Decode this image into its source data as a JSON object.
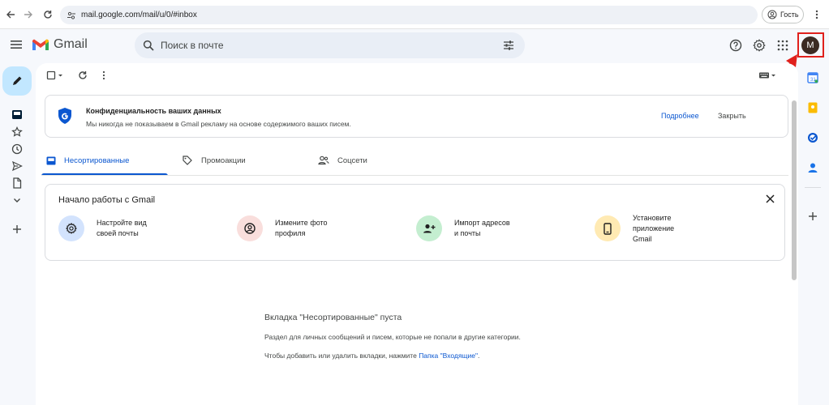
{
  "browser": {
    "url": "mail.google.com/mail/u/0/#inbox",
    "profile_label": "Гость"
  },
  "header": {
    "brand": "Gmail",
    "search_placeholder": "Поиск в почте",
    "avatar_letter": "M"
  },
  "privacy_banner": {
    "title": "Конфиденциальность ваших данных",
    "text": "Мы никогда не показываем в Gmail рекламу на основе содержимого ваших писем.",
    "more_label": "Подробнее",
    "close_label": "Закрыть"
  },
  "tabs": [
    {
      "label": "Несортированные",
      "active": true
    },
    {
      "label": "Промоакции",
      "active": false
    },
    {
      "label": "Соцсети",
      "active": false
    }
  ],
  "getting_started": {
    "title": "Начало работы с Gmail",
    "items": [
      {
        "label": "Настройте вид\nсвоей почты",
        "icon": "gear-icon",
        "color": "#d3e3fd"
      },
      {
        "label": "Измените фото\nпрофиля",
        "icon": "account-circle-icon",
        "color": "#f9dedc"
      },
      {
        "label": "Импорт адресов\nи почты",
        "icon": "person-add-icon",
        "color": "#c4eed0"
      },
      {
        "label": "Установите\nприложение\nGmail",
        "icon": "phone-icon",
        "color": "#ffeab3"
      }
    ]
  },
  "empty_state": {
    "title": "Вкладка \"Несортированные\" пуста",
    "line1": "Раздел для личных сообщений и писем, которые не попали в другие категории.",
    "line2_prefix": "Чтобы добавить или удалить вкладки, нажмите ",
    "line2_link": "Папка \"Входящие\"",
    "line2_suffix": "."
  },
  "colors": {
    "accent": "#0b57d0",
    "highlight": "#e0201c",
    "compose_bg": "#c2e7ff"
  }
}
